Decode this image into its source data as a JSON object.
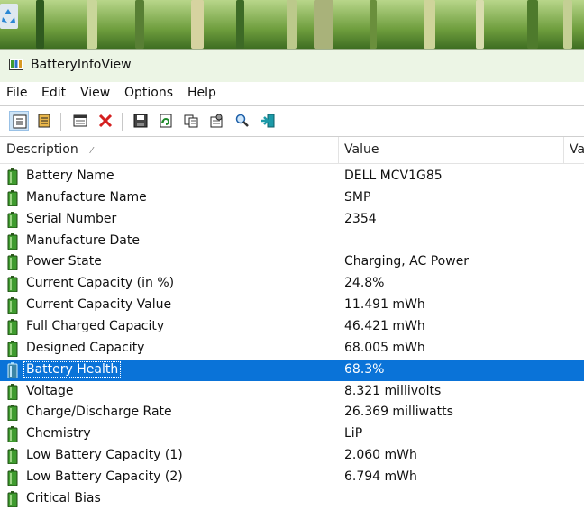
{
  "window": {
    "title": "BatteryInfoView",
    "app_icon": "battery-app-icon"
  },
  "desktop": {
    "icon": "recycle-bin-icon"
  },
  "menu": [
    "File",
    "Edit",
    "View",
    "Options",
    "Help"
  ],
  "toolbar": {
    "buttons": [
      "properties-view-icon",
      "list-view-icon",
      "log-window-icon",
      "delete-icon",
      "save-icon",
      "refresh-icon",
      "copy-icon",
      "properties-icon",
      "find-icon",
      "exit-icon"
    ]
  },
  "table": {
    "columns": [
      "Description",
      "Value",
      "Va"
    ],
    "rows": [
      {
        "description": "Battery Name",
        "value": "DELL MCV1G85"
      },
      {
        "description": "Manufacture Name",
        "value": "SMP"
      },
      {
        "description": "Serial Number",
        "value": "2354"
      },
      {
        "description": "Manufacture Date",
        "value": ""
      },
      {
        "description": "Power State",
        "value": "Charging, AC Power"
      },
      {
        "description": "Current Capacity (in %)",
        "value": "24.8%"
      },
      {
        "description": "Current Capacity Value",
        "value": "11.491 mWh"
      },
      {
        "description": "Full Charged Capacity",
        "value": "46.421 mWh"
      },
      {
        "description": "Designed Capacity",
        "value": "68.005 mWh"
      },
      {
        "description": "Battery Health",
        "value": "68.3%",
        "selected": true
      },
      {
        "description": "Voltage",
        "value": "8.321 millivolts"
      },
      {
        "description": "Charge/Discharge Rate",
        "value": "26.369 milliwatts"
      },
      {
        "description": "Chemistry",
        "value": "LiP"
      },
      {
        "description": "Low Battery Capacity (1)",
        "value": "2.060 mWh"
      },
      {
        "description": "Low Battery Capacity (2)",
        "value": "6.794 mWh"
      },
      {
        "description": "Critical Bias",
        "value": ""
      }
    ]
  },
  "colors": {
    "selection": "#0a73d8",
    "battery_green": "#3f9b2f",
    "titlebar_bg": "#ecf5e5"
  }
}
